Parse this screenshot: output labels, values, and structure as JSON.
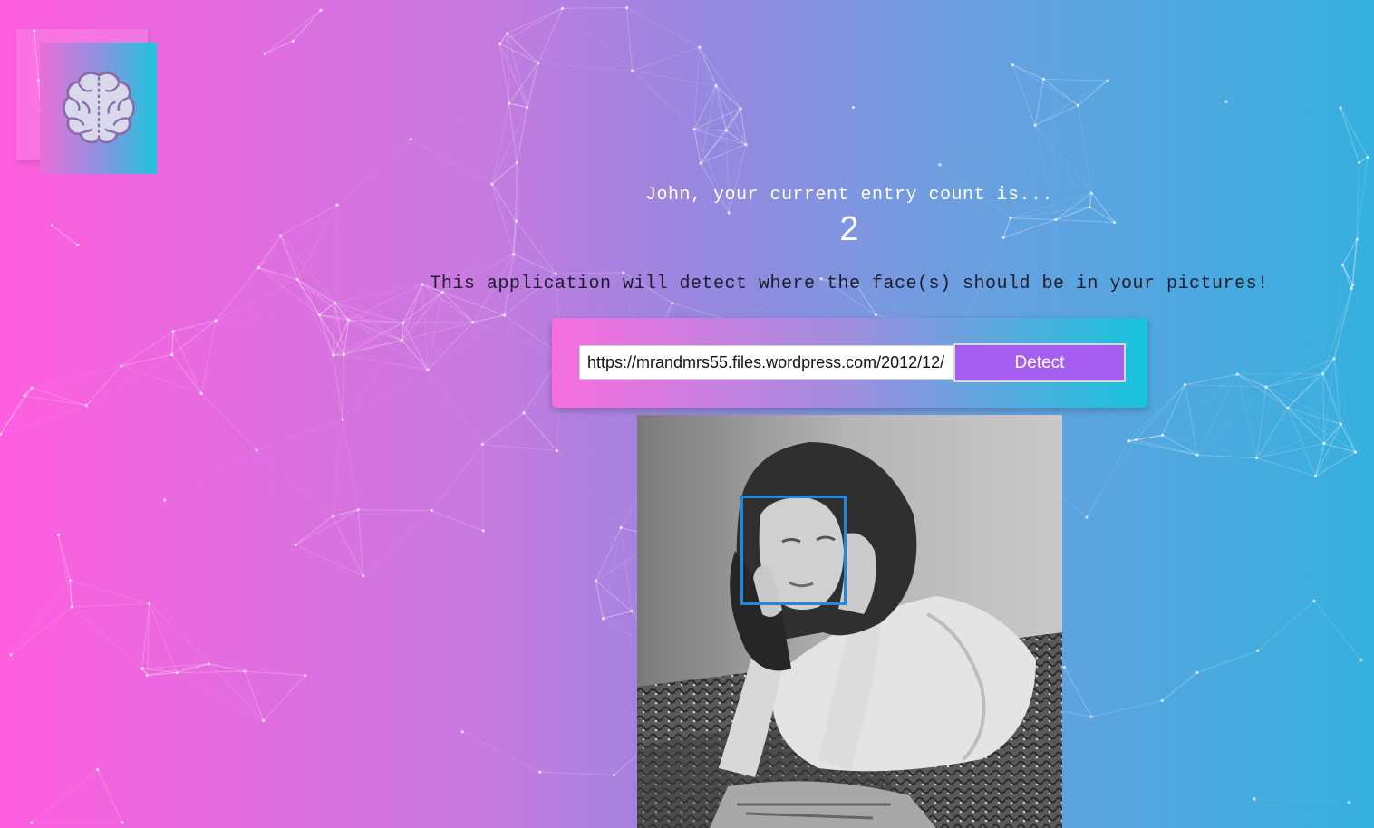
{
  "logo": {
    "icon": "brain-icon"
  },
  "greeting": "John, your current entry count is...",
  "entry_count": "2",
  "description": "This application will detect where the face(s) should be in your pictures!",
  "form": {
    "url_value": "https://mrandmrs55.files.wordpress.com/2012/12/",
    "detect_label": "Detect"
  },
  "colors": {
    "gradient_left": "#ff5edf",
    "gradient_right": "#35b0df",
    "button": "#a45ef0",
    "face_box": "#1e88e5"
  },
  "result": {
    "faces_detected": 1
  }
}
